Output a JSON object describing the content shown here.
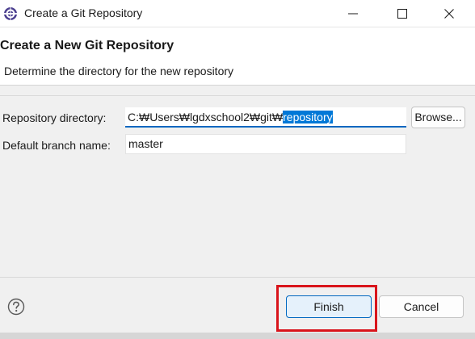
{
  "window": {
    "title": "Create a Git Repository",
    "icon": "eclipse-gear-icon"
  },
  "banner": {
    "title": "Create a New Git Repository",
    "description": "Determine the directory for the new repository"
  },
  "form": {
    "repository_directory": {
      "label": "Repository directory:",
      "value_prefix": "C:₩Users₩lgdxschool2₩git₩",
      "value_selected": "repository",
      "browse_label": "Browse..."
    },
    "default_branch": {
      "label": "Default branch name:",
      "value": "master"
    }
  },
  "footer": {
    "help_icon": "question-mark-icon",
    "finish_label": "Finish",
    "cancel_label": "Cancel"
  },
  "colors": {
    "selection": "#0078d7",
    "focus_border": "#0067c0",
    "annotation_highlight": "#d9141b"
  }
}
